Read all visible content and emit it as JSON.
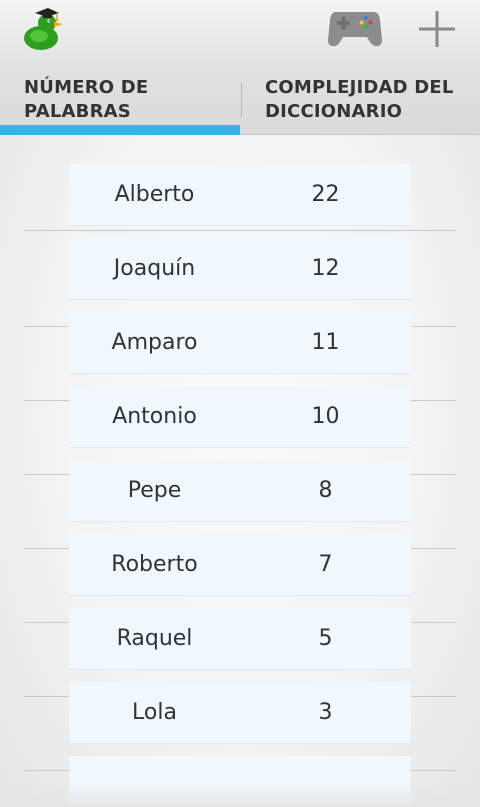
{
  "actionbar": {
    "logo_icon": "graduation-duck-icon",
    "game_icon": "gamepad-icon",
    "add_icon": "plus-icon"
  },
  "tabs": [
    {
      "label": "NÚMERO DE\nPALABRAS",
      "selected": true
    },
    {
      "label": "COMPLEJIDAD DEL\nDICCIONARIO",
      "selected": false
    }
  ],
  "colors": {
    "tab_indicator": "#33b5e5",
    "cell_background": "#f0f7fd",
    "duck_green": "#2e9e1f",
    "duck_beak": "#f3a31c"
  },
  "ranking": [
    {
      "name": "Alberto",
      "count": "22"
    },
    {
      "name": "Joaquín",
      "count": "12"
    },
    {
      "name": "Amparo",
      "count": "11"
    },
    {
      "name": "Antonio",
      "count": "10"
    },
    {
      "name": "Pepe",
      "count": "8"
    },
    {
      "name": "Roberto",
      "count": "7"
    },
    {
      "name": "Raquel",
      "count": "5"
    },
    {
      "name": "Lola",
      "count": "3"
    },
    {
      "name": "",
      "count": ""
    }
  ]
}
